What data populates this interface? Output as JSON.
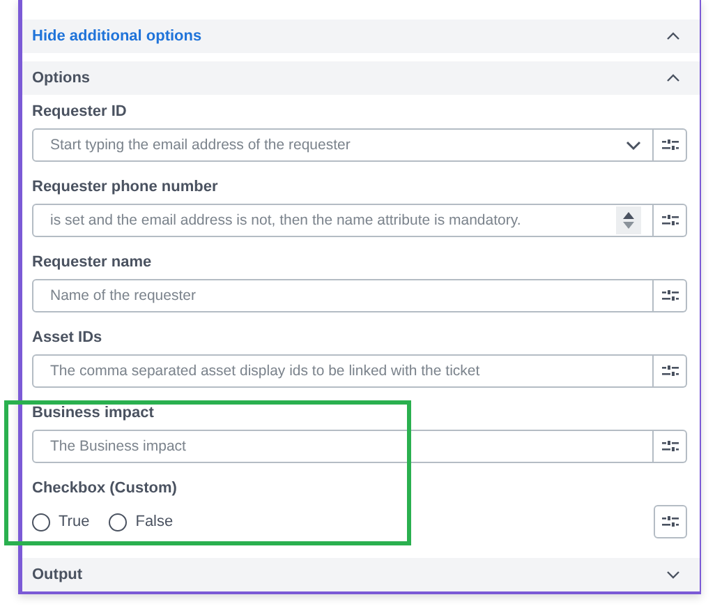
{
  "sections": [
    {
      "kind": "link",
      "title": "Hide additional options",
      "expanded": true
    },
    {
      "kind": "group",
      "title": "Options",
      "expanded": true,
      "fields": [
        {
          "kind": "select",
          "label": "Requester ID",
          "placeholder": "Start typing the email address of the requester"
        },
        {
          "kind": "number",
          "label": "Requester phone number",
          "placeholder": "is set and the email address is not, then the name attribute is mandatory."
        },
        {
          "kind": "text",
          "label": "Requester name",
          "placeholder": "Name of the requester"
        },
        {
          "kind": "text",
          "label": "Asset IDs",
          "placeholder": "The comma separated asset display ids to be linked with the ticket"
        },
        {
          "kind": "text",
          "label": "Business impact",
          "placeholder": "The Business impact"
        },
        {
          "kind": "radio",
          "label": "Checkbox (Custom)",
          "options": [
            {
              "label": "True",
              "selected": false
            },
            {
              "label": "False",
              "selected": false
            }
          ]
        }
      ]
    },
    {
      "kind": "group",
      "title": "Output",
      "expanded": false
    }
  ]
}
